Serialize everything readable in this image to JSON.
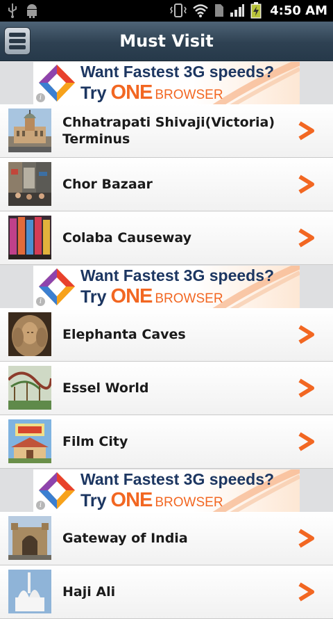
{
  "status_bar": {
    "time": "4:50 AM"
  },
  "header": {
    "title": "Must Visit"
  },
  "ad": {
    "headline": "Want Fastest 3G speeds?",
    "try": "Try",
    "brand": "ONE",
    "browser": "BROWSER",
    "info": "i"
  },
  "places": [
    {
      "label": "Chhatrapati Shivaji(Victoria) Terminus",
      "icon": "victoria-terminus-thumbnail"
    },
    {
      "label": "Chor Bazaar",
      "icon": "chor-bazaar-thumbnail"
    },
    {
      "label": "Colaba Causeway",
      "icon": "colaba-causeway-thumbnail"
    },
    {
      "label": "Elephanta Caves",
      "icon": "elephanta-caves-thumbnail"
    },
    {
      "label": "Essel World",
      "icon": "essel-world-thumbnail"
    },
    {
      "label": "Film City",
      "icon": "film-city-thumbnail"
    },
    {
      "label": "Gateway of India",
      "icon": "gateway-of-india-thumbnail"
    },
    {
      "label": "Haji Ali",
      "icon": "haji-ali-thumbnail"
    }
  ],
  "colors": {
    "accent": "#f26722",
    "title_bar": "#2e4152",
    "ad_text": "#1c3661"
  }
}
